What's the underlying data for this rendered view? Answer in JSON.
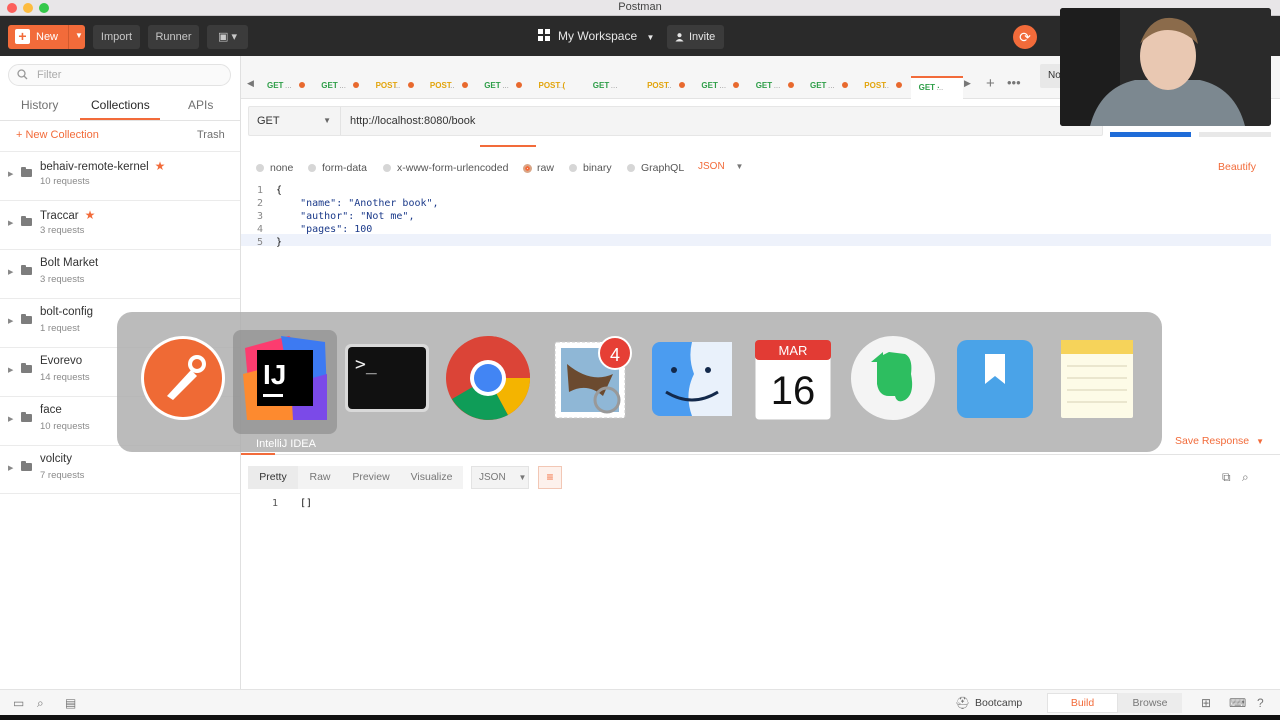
{
  "window": {
    "title": "Postman"
  },
  "header": {
    "new_label": "New",
    "import_label": "Import",
    "runner_label": "Runner",
    "workspace_label": "My Workspace",
    "invite_label": "Invite"
  },
  "sidebar": {
    "filter_placeholder": "Filter",
    "tabs": [
      "History",
      "Collections",
      "APIs"
    ],
    "new_collection_label": "+ New Collection",
    "trash_label": "Trash",
    "collections": [
      {
        "name": "behaiv-remote-kernel",
        "count": "10 requests",
        "starred": true
      },
      {
        "name": "Traccar",
        "count": "3 requests",
        "starred": true
      },
      {
        "name": "Bolt Market",
        "count": "3 requests",
        "starred": false
      },
      {
        "name": "bolt-config",
        "count": "1 request",
        "starred": false
      },
      {
        "name": "Evorevo",
        "count": "14 requests",
        "starred": false
      },
      {
        "name": "face",
        "count": "10 requests",
        "starred": false
      },
      {
        "name": "volcity",
        "count": "7 requests",
        "starred": false
      }
    ]
  },
  "tabs": [
    {
      "method": "GET",
      "dot": true
    },
    {
      "method": "GET",
      "dot": true
    },
    {
      "method": "POST",
      "dot": true
    },
    {
      "method": "POST",
      "dot": true
    },
    {
      "method": "GET",
      "dot": true
    },
    {
      "method": "POST (",
      "dot": false
    },
    {
      "method": "GET",
      "dot": false
    },
    {
      "method": "POST",
      "dot": true
    },
    {
      "method": "GET",
      "dot": true
    },
    {
      "method": "GET",
      "dot": true
    },
    {
      "method": "GET",
      "dot": true
    },
    {
      "method": "POST",
      "dot": true
    },
    {
      "method": "GET ·",
      "dot": false
    }
  ],
  "environment": {
    "label": "No"
  },
  "request": {
    "method": "GET",
    "url": "http://localhost:8080/book"
  },
  "body": {
    "types": [
      "none",
      "form-data",
      "x-www-form-urlencoded",
      "raw",
      "binary",
      "GraphQL"
    ],
    "selected": "raw",
    "format": "JSON",
    "beautify_label": "Beautify",
    "lines": [
      {
        "n": "1",
        "text": "{"
      },
      {
        "n": "2",
        "text": "    \"name\": \"Another book\","
      },
      {
        "n": "3",
        "text": "    \"author\": \"Not me\","
      },
      {
        "n": "4",
        "text": "    \"pages\": 100"
      },
      {
        "n": "5",
        "text": "}"
      }
    ]
  },
  "response": {
    "save_label": "Save Response",
    "tabs": [
      "Pretty",
      "Raw",
      "Preview",
      "Visualize"
    ],
    "format": "JSON",
    "line_number": "1",
    "content": "[]"
  },
  "statusbar": {
    "bootcamp_label": "Bootcamp",
    "build_label": "Build",
    "browse_label": "Browse"
  },
  "switcher": {
    "selected_app": "IntelliJ IDEA",
    "apps": [
      "Postman",
      "IntelliJ IDEA",
      "Terminal",
      "Google Chrome",
      "Mail",
      "Finder",
      "Calendar",
      "Evernote",
      "Day One",
      "Notes"
    ],
    "mail_badge": "4",
    "calendar_month": "MAR",
    "calendar_day": "16",
    "terminal_prompt": ">_",
    "intellij_mark": "IJ"
  },
  "colors": {
    "accent": "#f26b3a",
    "header_bg": "#2a2a2a",
    "get": "#2e9e48",
    "post": "#e2a40b",
    "send_blue": "#1f6cd8"
  }
}
